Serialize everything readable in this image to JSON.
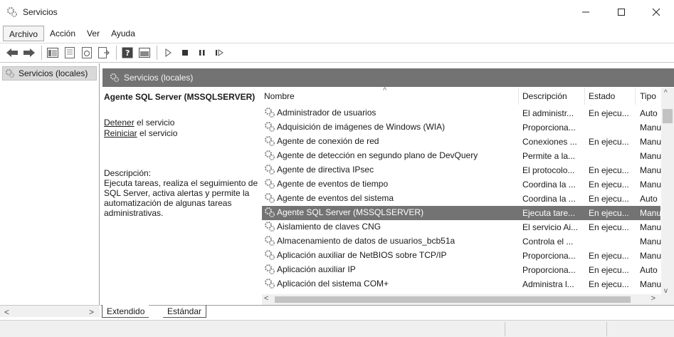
{
  "window": {
    "title": "Servicios",
    "minimize_label": "Minimize",
    "maximize_label": "Maximize",
    "close_label": "Close"
  },
  "menu": {
    "items": [
      "Archivo",
      "Acción",
      "Ver",
      "Ayuda"
    ]
  },
  "tree": {
    "root_label": "Servicios (locales)"
  },
  "panel": {
    "header": "Servicios (locales)",
    "selected_service": "Agente SQL Server (MSSQLSERVER)",
    "action_stop_link": "Detener",
    "action_stop_suffix": " el servicio",
    "action_restart_link": "Reiniciar",
    "action_restart_suffix": " el servicio",
    "description_label": "Descripción:",
    "description_text": "Ejecuta tareas, realiza el seguimiento de SQL Server, activa alertas y permite la automatización de algunas tareas administrativas."
  },
  "table": {
    "columns": [
      "Nombre",
      "Descripción",
      "Estado",
      "Tipo"
    ],
    "rows": [
      {
        "name": "Administrador de usuarios",
        "desc": "El administr...",
        "status": "En ejecu...",
        "type": "Auto"
      },
      {
        "name": "Adquisición de imágenes de Windows (WIA)",
        "desc": "Proporciona...",
        "status": "",
        "type": "Manu"
      },
      {
        "name": "Agente de conexión de red",
        "desc": "Conexiones ...",
        "status": "En ejecu...",
        "type": "Manu"
      },
      {
        "name": "Agente de detección en segundo plano de DevQuery",
        "desc": "Permite a la...",
        "status": "",
        "type": "Manu"
      },
      {
        "name": "Agente de directiva IPsec",
        "desc": "El protocolo...",
        "status": "En ejecu...",
        "type": "Manu"
      },
      {
        "name": "Agente de eventos de tiempo",
        "desc": "Coordina la ...",
        "status": "En ejecu...",
        "type": "Manu"
      },
      {
        "name": "Agente de eventos del sistema",
        "desc": "Coordina la ...",
        "status": "En ejecu...",
        "type": "Auto"
      },
      {
        "name": "Agente SQL Server (MSSQLSERVER)",
        "desc": "Ejecuta tare...",
        "status": "En ejecu...",
        "type": "Manu",
        "selected": true
      },
      {
        "name": "Aislamiento de claves CNG",
        "desc": "El servicio Ai...",
        "status": "En ejecu...",
        "type": "Manu"
      },
      {
        "name": "Almacenamiento de datos de usuarios_bcb51a",
        "desc": "Controla el ...",
        "status": "",
        "type": "Manu"
      },
      {
        "name": "Aplicación auxiliar de NetBIOS sobre TCP/IP",
        "desc": "Proporciona...",
        "status": "En ejecu...",
        "type": "Manu"
      },
      {
        "name": "Aplicación auxiliar IP",
        "desc": "Proporciona...",
        "status": "En ejecu...",
        "type": "Auto"
      },
      {
        "name": "Aplicación del sistema COM+",
        "desc": "Administra l...",
        "status": "En ejecu...",
        "type": "Manu"
      }
    ]
  },
  "tabs": {
    "extended": "Extendido",
    "standard": "Estándar"
  },
  "colors": {
    "selection": "#737373",
    "header_bar": "#737373"
  }
}
